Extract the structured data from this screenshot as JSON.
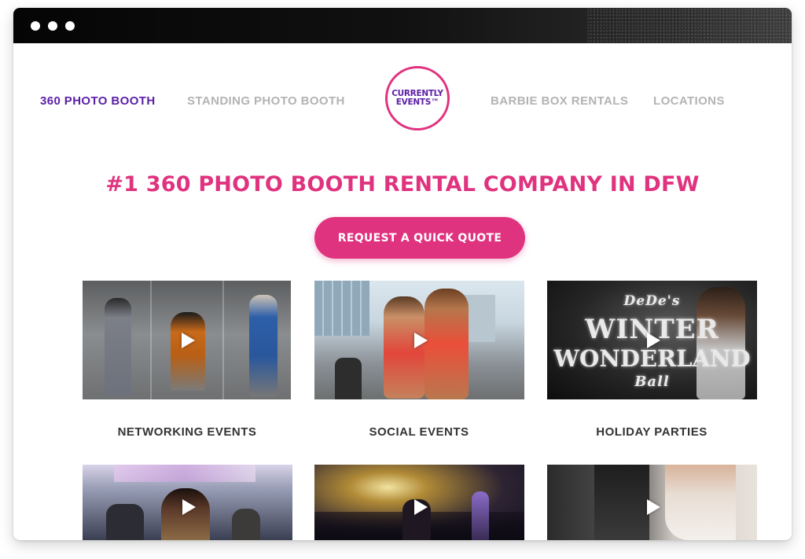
{
  "nav": {
    "left": [
      "360 PHOTO BOOTH",
      "STANDING PHOTO BOOTH"
    ],
    "right": [
      "BARBIE BOX RENTALS",
      "LOCATIONS"
    ],
    "active_index": 0
  },
  "logo": {
    "line1": "CURRENTLY",
    "line2": "EVENTS™"
  },
  "hero": {
    "headline": "#1 360 PHOTO BOOTH RENTAL COMPANY IN DFW",
    "cta_label": "REQUEST A QUICK QUOTE"
  },
  "videos": [
    {
      "caption": "NETWORKING EVENTS"
    },
    {
      "caption": "SOCIAL EVENTS"
    },
    {
      "caption": "HOLIDAY PARTIES",
      "overlay": {
        "line1": "DeDe's",
        "line2": "WINTER",
        "line3": "WONDERLAND",
        "line4": "Ball"
      }
    },
    {
      "caption": ""
    },
    {
      "caption": ""
    },
    {
      "caption": ""
    }
  ],
  "colors": {
    "brand_pink": "#e0337f",
    "brand_purple": "#5b1fa6",
    "nav_gray": "#b3b3b3"
  }
}
